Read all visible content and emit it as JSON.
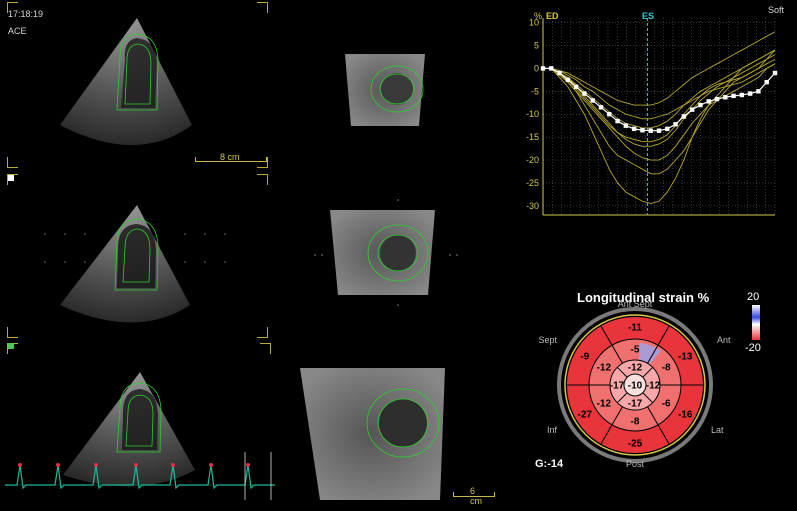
{
  "header": {
    "time": "17:18:19",
    "mode": "ACE",
    "preset": "Soft"
  },
  "scales": {
    "top_left": "8 cm",
    "bottom_mid": "6 cm"
  },
  "curve_labels": {
    "pct": "%",
    "ed": "ED",
    "es": "ES"
  },
  "chart_data": {
    "type": "line",
    "title": "",
    "xlabel": "",
    "ylabel": "%",
    "ylim": [
      -32,
      11
    ],
    "yticks": [
      10,
      5,
      0,
      -5,
      -10,
      -15,
      -20,
      -25,
      -30
    ],
    "markers": [
      "ED",
      "ES"
    ],
    "series": [
      {
        "role": "average",
        "color": "#ffffff",
        "values": [
          0,
          0,
          -1,
          -2.5,
          -4,
          -5.5,
          -7,
          -8.5,
          -10,
          -11.5,
          -12.5,
          -13.2,
          -13.5,
          -13.6,
          -13.6,
          -13.2,
          -12.2,
          -10.5,
          -9,
          -8,
          -7.2,
          -6.7,
          -6.3,
          -6,
          -5.8,
          -5.5,
          -5,
          -3,
          -1
        ]
      },
      {
        "role": "segment",
        "color": "#b8a830",
        "values": [
          0,
          0,
          -1,
          -3,
          -5,
          -8,
          -11,
          -14,
          -17,
          -19,
          -20,
          -21,
          -22,
          -23,
          -23,
          -22,
          -20,
          -18,
          -15,
          -12,
          -9,
          -7,
          -5,
          -3,
          -2,
          -1,
          0,
          1,
          2
        ]
      },
      {
        "role": "segment",
        "color": "#b8a830",
        "values": [
          0,
          0,
          -2,
          -4,
          -7,
          -10,
          -14,
          -18,
          -22,
          -25,
          -27,
          -28,
          -29,
          -29.5,
          -29,
          -27,
          -24,
          -20,
          -15,
          -11,
          -8,
          -6,
          -4,
          -2,
          0,
          1,
          2,
          3,
          4
        ]
      },
      {
        "role": "segment",
        "color": "#b8a830",
        "values": [
          0,
          0,
          -0.5,
          -1,
          -2,
          -3,
          -4,
          -5,
          -6,
          -7,
          -7.5,
          -8,
          -8,
          -8,
          -7.5,
          -6.5,
          -5,
          -3.5,
          -2,
          -1,
          0,
          1,
          2,
          3,
          4,
          5,
          6,
          7,
          8
        ]
      },
      {
        "role": "segment",
        "color": "#b8a830",
        "values": [
          0,
          0,
          -1,
          -2,
          -4,
          -6,
          -8,
          -10,
          -12,
          -14,
          -15.5,
          -16.5,
          -17,
          -17,
          -16.5,
          -15.5,
          -13.5,
          -11,
          -9,
          -7,
          -5.5,
          -4,
          -3,
          -2,
          -1,
          0,
          1,
          2,
          3
        ]
      },
      {
        "role": "segment",
        "color": "#b8a830",
        "values": [
          0,
          0,
          -1.5,
          -3,
          -5,
          -7,
          -9,
          -11,
          -13,
          -15,
          -17,
          -18.5,
          -19.5,
          -20,
          -20,
          -19,
          -17,
          -14.5,
          -12,
          -10,
          -8,
          -7,
          -6,
          -5,
          -4,
          -3,
          -2,
          0,
          1
        ]
      },
      {
        "role": "segment",
        "color": "#b8a830",
        "values": [
          0,
          0,
          -0.5,
          -1.5,
          -2.5,
          -4,
          -5,
          -6.5,
          -8,
          -9,
          -10,
          -10.5,
          -11,
          -11,
          -10.5,
          -10,
          -9,
          -8,
          -7,
          -6,
          -5,
          -4.5,
          -4,
          -3.5,
          -3,
          -2,
          -1,
          0,
          1
        ]
      },
      {
        "role": "segment",
        "color": "#b8a830",
        "values": [
          0,
          0,
          -1,
          -2,
          -3.5,
          -5,
          -6.5,
          -8,
          -9.5,
          -11,
          -12,
          -12.5,
          -13,
          -13,
          -12.5,
          -11.5,
          -10,
          -8,
          -6.5,
          -5,
          -4,
          -3,
          -2,
          -1,
          0,
          1,
          2,
          3,
          4
        ]
      },
      {
        "role": "segment",
        "color": "#b8a830",
        "values": [
          0,
          0,
          -1,
          -2.5,
          -4.5,
          -6.5,
          -8.5,
          -10.5,
          -12.5,
          -14,
          -15,
          -15.5,
          -16,
          -16,
          -15.5,
          -14.5,
          -12.5,
          -10,
          -8,
          -6,
          -4.5,
          -3.5,
          -3,
          -2.5,
          -2,
          -1,
          0,
          2,
          4
        ]
      }
    ]
  },
  "bullseye": {
    "title": "Longitudinal strain %",
    "scale_max": "20",
    "scale_min": "-20",
    "labels": {
      "top": "Ant Sept",
      "right_top": "Ant",
      "right_bottom": "Lat",
      "bottom": "Post",
      "left_bottom": "Inf",
      "left_top": "Sept"
    },
    "outer": [
      "-11",
      "-13",
      "-16",
      "-25",
      "-27",
      "-9"
    ],
    "mid": [
      "-5",
      "-8",
      "-6",
      "-8",
      "-12",
      "-12"
    ],
    "apical": [
      "-12",
      "-12",
      "-17",
      "-17"
    ],
    "apex": "-10",
    "global": "G:-14"
  },
  "colors": {
    "accent": "#d4c84a",
    "bullseye_red": "#e8343a",
    "ecg": "#1fb89a"
  }
}
